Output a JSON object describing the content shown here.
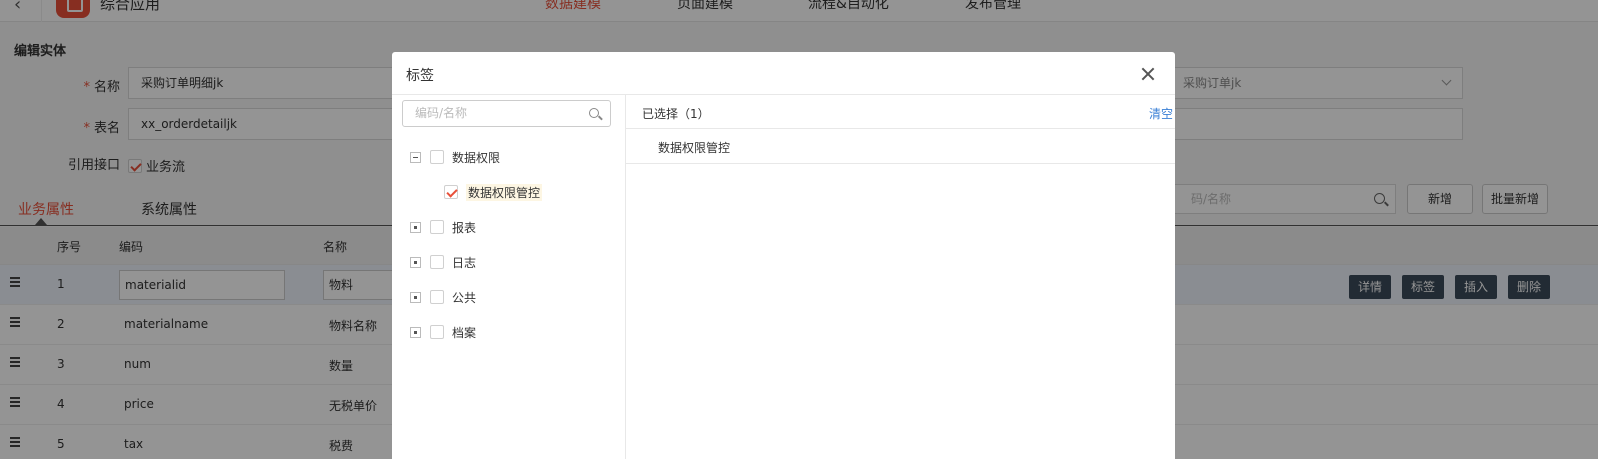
{
  "topbar": {
    "app_name": "综合应用",
    "nav": [
      "数据建模",
      "页面建模",
      "流程&自动化",
      "发布管理"
    ]
  },
  "form": {
    "section_title": "编辑实体",
    "name_label": "名称",
    "name_value": "采购订单明细jk",
    "table_label": "表名",
    "table_value": "xx_orderdetailjk",
    "select_value": "采购订单jk",
    "ref_label": "引用接口",
    "ref_option": "业务流"
  },
  "tabs": [
    "业务属性",
    "系统属性"
  ],
  "toolbar": {
    "search_placeholder": "码/名称",
    "add_label": "新增",
    "batch_add_label": "批量新增"
  },
  "table": {
    "headers": [
      "序号",
      "编码",
      "名称"
    ],
    "rows": [
      {
        "no": "1",
        "code": "materialid",
        "name": "物料"
      },
      {
        "no": "2",
        "code": "materialname",
        "name": "物料名称"
      },
      {
        "no": "3",
        "code": "num",
        "name": "数量"
      },
      {
        "no": "4",
        "code": "price",
        "name": "无税单价"
      },
      {
        "no": "5",
        "code": "tax",
        "name": "税费"
      }
    ],
    "row_actions": [
      "详情",
      "标签",
      "插入",
      "删除"
    ]
  },
  "modal": {
    "title": "标签",
    "search_placeholder": "编码/名称",
    "tree": [
      {
        "label": "数据权限",
        "expanded": true,
        "checked": false,
        "children": [
          {
            "label": "数据权限管控",
            "checked": true
          }
        ]
      },
      {
        "label": "报表",
        "expanded": false,
        "checked": false
      },
      {
        "label": "日志",
        "expanded": false,
        "checked": false
      },
      {
        "label": "公共",
        "expanded": false,
        "checked": false
      },
      {
        "label": "档案",
        "expanded": false,
        "checked": false
      }
    ],
    "selected_count_text": "已选择（1）",
    "clear_label": "清空",
    "selected_items": [
      "数据权限管控"
    ]
  },
  "colors": {
    "accent": "#e8503a",
    "link": "#3a7fd6",
    "action_button": "#3c4a5a"
  }
}
